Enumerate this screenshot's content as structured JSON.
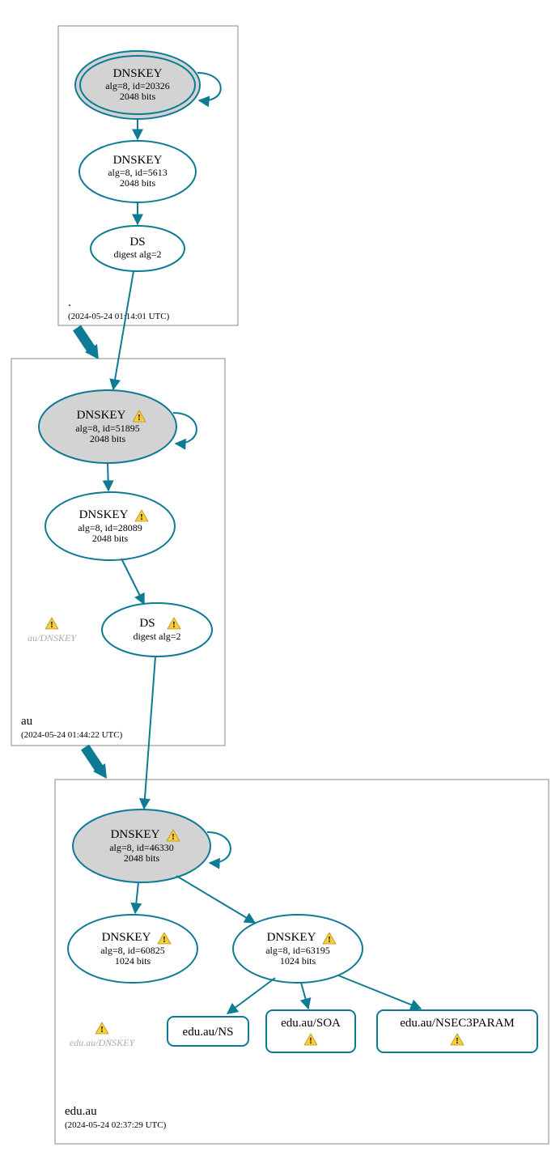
{
  "zones": {
    "root": {
      "title": ".",
      "timestamp": "(2024-05-24 01:14:01 UTC)"
    },
    "au": {
      "title": "au",
      "timestamp": "(2024-05-24 01:44:22 UTC)"
    },
    "edu": {
      "title": "edu.au",
      "timestamp": "(2024-05-24 02:37:29 UTC)"
    }
  },
  "side_labels": {
    "au": "au/DNSKEY",
    "edu": "edu.au/DNSKEY"
  },
  "nodes": {
    "root_ksk": {
      "title": "DNSKEY",
      "l1": "alg=8, id=20326",
      "l2": "2048 bits"
    },
    "root_zsk": {
      "title": "DNSKEY",
      "l1": "alg=8, id=5613",
      "l2": "2048 bits"
    },
    "root_ds": {
      "title": "DS",
      "l1": "digest alg=2"
    },
    "au_ksk": {
      "title": "DNSKEY",
      "l1": "alg=8, id=51895",
      "l2": "2048 bits"
    },
    "au_zsk": {
      "title": "DNSKEY",
      "l1": "alg=8, id=28089",
      "l2": "2048 bits"
    },
    "au_ds": {
      "title": "DS",
      "l1": "digest alg=2"
    },
    "edu_ksk": {
      "title": "DNSKEY",
      "l1": "alg=8, id=46330",
      "l2": "2048 bits"
    },
    "edu_zsk1": {
      "title": "DNSKEY",
      "l1": "alg=8, id=60825",
      "l2": "1024 bits"
    },
    "edu_zsk2": {
      "title": "DNSKEY",
      "l1": "alg=8, id=63195",
      "l2": "1024 bits"
    },
    "rr_ns": {
      "title": "edu.au/NS"
    },
    "rr_soa": {
      "title": "edu.au/SOA"
    },
    "rr_nsec3": {
      "title": "edu.au/NSEC3PARAM"
    }
  },
  "chart_data": {
    "type": "dnssec-authentication-graph",
    "zones": [
      {
        "name": ".",
        "analyzed": "2024-05-24 01:14:01 UTC",
        "keys": [
          {
            "type": "DNSKEY",
            "alg": 8,
            "id": 20326,
            "bits": 2048,
            "role": "KSK",
            "trust_anchor": true
          },
          {
            "type": "DNSKEY",
            "alg": 8,
            "id": 5613,
            "bits": 2048,
            "role": "ZSK"
          }
        ],
        "ds": [
          {
            "digest_alg": 2,
            "delegates_to": "au"
          }
        ]
      },
      {
        "name": "au",
        "analyzed": "2024-05-24 01:44:22 UTC",
        "warnings": true,
        "keys": [
          {
            "type": "DNSKEY",
            "alg": 8,
            "id": 51895,
            "bits": 2048,
            "role": "KSK",
            "warning": true
          },
          {
            "type": "DNSKEY",
            "alg": 8,
            "id": 28089,
            "bits": 2048,
            "role": "ZSK",
            "warning": true
          }
        ],
        "ds": [
          {
            "digest_alg": 2,
            "delegates_to": "edu.au",
            "warning": true
          }
        ]
      },
      {
        "name": "edu.au",
        "analyzed": "2024-05-24 02:37:29 UTC",
        "warnings": true,
        "keys": [
          {
            "type": "DNSKEY",
            "alg": 8,
            "id": 46330,
            "bits": 2048,
            "role": "KSK",
            "warning": true
          },
          {
            "type": "DNSKEY",
            "alg": 8,
            "id": 60825,
            "bits": 1024,
            "role": "ZSK",
            "warning": true
          },
          {
            "type": "DNSKEY",
            "alg": 8,
            "id": 63195,
            "bits": 1024,
            "role": "ZSK",
            "warning": true
          }
        ],
        "rrsets": [
          {
            "name": "edu.au/NS"
          },
          {
            "name": "edu.au/SOA",
            "warning": true
          },
          {
            "name": "edu.au/NSEC3PARAM",
            "warning": true
          }
        ]
      }
    ],
    "edges": [
      [
        "root:20326",
        "root:20326",
        "self-sign"
      ],
      [
        "root:20326",
        "root:5613"
      ],
      [
        "root:5613",
        "root:DS"
      ],
      [
        "root:DS",
        "au:51895"
      ],
      [
        "au:51895",
        "au:51895",
        "self-sign"
      ],
      [
        "au:51895",
        "au:28089"
      ],
      [
        "au:28089",
        "au:DS"
      ],
      [
        "au:DS",
        "edu.au:46330"
      ],
      [
        "edu.au:46330",
        "edu.au:46330",
        "self-sign"
      ],
      [
        "edu.au:46330",
        "edu.au:60825"
      ],
      [
        "edu.au:46330",
        "edu.au:63195"
      ],
      [
        "edu.au:63195",
        "edu.au/NS"
      ],
      [
        "edu.au:63195",
        "edu.au/SOA"
      ],
      [
        "edu.au:63195",
        "edu.au/NSEC3PARAM"
      ]
    ]
  }
}
